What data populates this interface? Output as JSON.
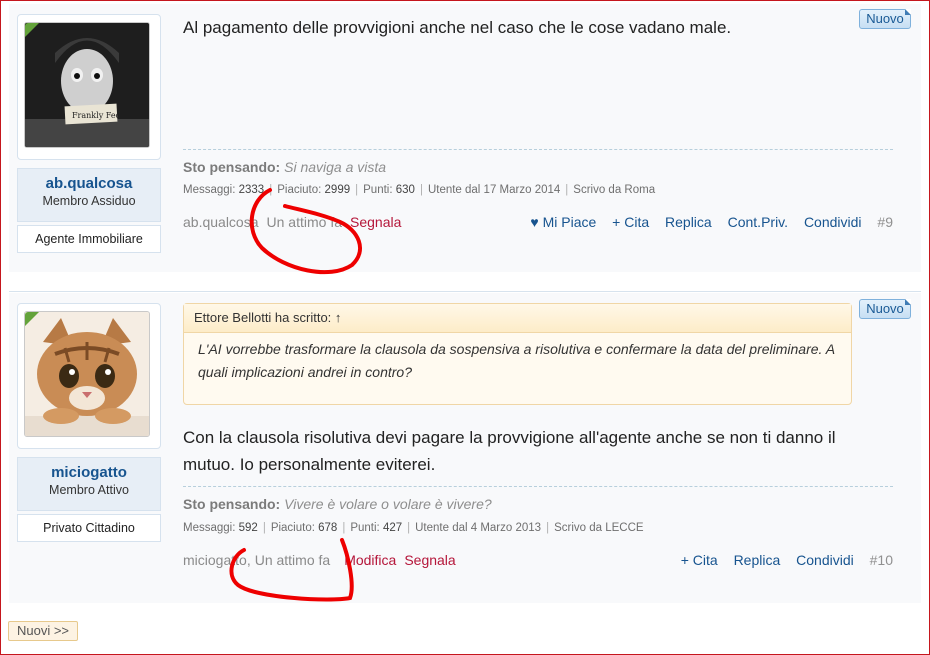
{
  "posts": [
    {
      "badge": "Nuovo",
      "username": "ab.qualcosa",
      "user_title": "Membro Assiduo",
      "user_role": "Agente Immobiliare",
      "message": "Al pagamento delle provvigioni anche nel caso che le cose vadano male.",
      "status_label": "Sto pensando:",
      "status_text": "Si naviga a vista",
      "stats": {
        "messaggi_label": "Messaggi:",
        "messaggi": "2333",
        "piaciuto_label": "Piaciuto:",
        "piaciuto": "2999",
        "punti_label": "Punti:",
        "punti": "630",
        "utente": "Utente dal 17 Marzo 2014",
        "scrivo": "Scrivo da Roma"
      },
      "footer_user": "ab.qualcosa",
      "footer_time": "Un attimo fa",
      "report": "Segnala",
      "actions": {
        "like": "Mi Piace",
        "quote": "+ Cita",
        "reply": "Replica",
        "pm": "Cont.Priv.",
        "share": "Condividi"
      },
      "post_number": "#9"
    },
    {
      "badge": "Nuovo",
      "username": "miciogatto",
      "user_title": "Membro Attivo",
      "user_role": "Privato Cittadino",
      "quote_header": "Ettore Bellotti ha scritto: ↑",
      "quote_text": "L'AI vorrebbe trasformare la clausola da sospensiva a risolutiva e confermare la data del preliminare. A quali implicazioni andrei in contro?",
      "message": "Con la clausola risolutiva devi pagare la provvigione all'agente anche se non ti danno il mutuo. Io personalmente eviterei.",
      "status_label": "Sto pensando:",
      "status_text": "Vivere è volare o volare è vivere?",
      "stats": {
        "messaggi_label": "Messaggi:",
        "messaggi": "592",
        "piaciuto_label": "Piaciuto:",
        "piaciuto": "678",
        "punti_label": "Punti:",
        "punti": "427",
        "utente": "Utente dal 4 Marzo 2013",
        "scrivo": "Scrivo da LECCE"
      },
      "footer_user": "miciogatto",
      "footer_time": "Un attimo fa",
      "edit": "Modifica",
      "report": "Segnala",
      "actions": {
        "quote": "+ Cita",
        "reply": "Replica",
        "share": "Condividi"
      },
      "post_number": "#10"
    }
  ],
  "nav": {
    "newer": "Nuovi >>"
  },
  "colors": {
    "link": "#17548f",
    "report": "#b5163a",
    "online": "#64a33b",
    "frame": "#c5161d",
    "scribble": "#ee0000"
  }
}
